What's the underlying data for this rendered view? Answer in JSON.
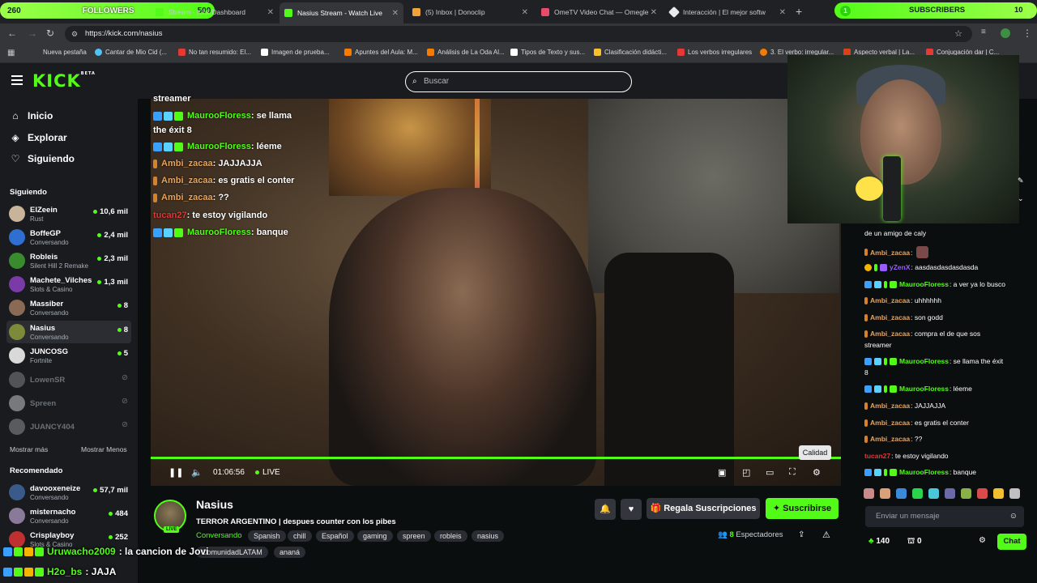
{
  "browser": {
    "tabs": [
      {
        "label": "Stream - Kick Dashboard"
      },
      {
        "label": "Nasius Stream - Watch Live"
      },
      {
        "label": "(5) Inbox | Donoclip"
      },
      {
        "label": "OmeTV Video Chat — Omegle"
      },
      {
        "label": "Interacción | El mejor softw"
      }
    ],
    "url": "https://kick.com/nasius",
    "bookmarks": [
      "Nueva pestaña",
      "Cantar de Mio Cid (...",
      "No tan resumido: El...",
      "Imagen de prueba...",
      "Apuntes del Aula: M...",
      "Análisis de La Oda Al...",
      "Tipos de Texto y sus...",
      "Clasificación didácti...",
      "Los verbos irregulares",
      "3. El verbo: irregular...",
      "Aspecto verbal | La...",
      "Conjugación dar | C..."
    ]
  },
  "overlay": {
    "followers_count": "260",
    "followers_label": "FOLLOWERS",
    "followers_goal": "500",
    "subs_count": "1",
    "subs_label": "SUBSCRIBERS",
    "subs_goal": "10",
    "bottom_chat": [
      {
        "user": "Uruwacho2009",
        "text": ": la cancion de Jovi",
        "color": "#53fc18"
      },
      {
        "user": "H2o_bs",
        "text": ": JAJA",
        "color": "#53fc18"
      }
    ]
  },
  "kick": {
    "logo": "KICK",
    "logo_badge": "BETA",
    "search_placeholder": "Buscar"
  },
  "sidebar": {
    "nav": [
      {
        "label": "Inicio",
        "icon": "home-icon"
      },
      {
        "label": "Explorar",
        "icon": "compass-icon"
      },
      {
        "label": "Siguiendo",
        "icon": "heart-icon"
      }
    ],
    "following_title": "Siguiendo",
    "following": [
      {
        "name": "ElZeein",
        "category": "Rust",
        "viewers": "10,6 mil",
        "color": "#c9b49a"
      },
      {
        "name": "BoffeGP",
        "category": "Conversando",
        "viewers": "2,4 mil",
        "color": "#2f6fd1"
      },
      {
        "name": "Robleis",
        "category": "Silent Hill 2 Remake",
        "viewers": "2,3 mil",
        "color": "#3a8a2e"
      },
      {
        "name": "Machete_Vilches",
        "category": "Slots & Casino",
        "viewers": "1,3 mil",
        "color": "#7a3aa8"
      },
      {
        "name": "Massiber",
        "category": "Conversando",
        "viewers": "8",
        "color": "#8a6a55"
      },
      {
        "name": "Nasius",
        "category": "Conversando",
        "viewers": "8",
        "color": "#7c8a3a"
      },
      {
        "name": "JUNCOSG",
        "category": "Fortnite",
        "viewers": "5",
        "color": "#d9d9d9"
      },
      {
        "name": "LowenSR",
        "category": "",
        "viewers": "",
        "color": "#999"
      },
      {
        "name": "Spreen",
        "category": "",
        "viewers": "",
        "color": "#eee"
      },
      {
        "name": "JUANCY404",
        "category": "",
        "viewers": "",
        "color": "#aaa"
      }
    ],
    "show_more": "Mostrar más",
    "show_less": "Mostrar Menos",
    "recommended_title": "Recomendado",
    "recommended": [
      {
        "name": "davooxeneize",
        "category": "Conversando",
        "viewers": "57,7 mil",
        "color": "#3a5a8a"
      },
      {
        "name": "misternacho",
        "category": "Conversando",
        "viewers": "484",
        "color": "#8a7a9a"
      },
      {
        "name": "Crisplayboy",
        "category": "Slots & Casino",
        "viewers": "252",
        "color": "#c03030"
      }
    ]
  },
  "video_chat": [
    {
      "user": "",
      "text": "streamer",
      "color": "#ffffff",
      "badges": 0
    },
    {
      "user": "MaurooFloress",
      "text": ": se llama",
      "color": "#53fc18",
      "badges": 3
    },
    {
      "user": "",
      "text": "the éxit 8",
      "color": "#ffffff",
      "badges": 0
    },
    {
      "user": "MaurooFloress",
      "text": ": léeme",
      "color": "#53fc18",
      "badges": 3
    },
    {
      "user": "Ambi_zacaa",
      "text": ": JAJJAJJA",
      "color": "#e8a35b",
      "badges": 1
    },
    {
      "user": "Ambi_zacaa",
      "text": ": es gratis el conter",
      "color": "#e8a35b",
      "badges": 1
    },
    {
      "user": "Ambi_zacaa",
      "text": ": ??",
      "color": "#e8a35b",
      "badges": 1
    },
    {
      "user": "tucan27",
      "text": ": te estoy vigilando",
      "color": "#d93a3a",
      "badges": 0
    },
    {
      "user": "MaurooFloress",
      "text": ": banque",
      "color": "#53fc18",
      "badges": 3
    }
  ],
  "player": {
    "time": "01:06:56",
    "live_label": "LIVE",
    "tooltip": "Calidad"
  },
  "stream": {
    "name": "Nasius",
    "title": "TERROR ARGENTINO | despues counter con los pibes",
    "category": "Conversando",
    "tags": [
      "Spanish",
      "chill",
      "Español",
      "gaming",
      "spreen",
      "robleis",
      "nasius",
      "ComunidadLATAM",
      "ananá"
    ],
    "gift_label": "Regala Suscripciones",
    "subscribe_label": "Suscribirse",
    "viewers": "8",
    "viewers_label": "Espectadores",
    "live_badge": "LIVE"
  },
  "chat": {
    "messages": [
      {
        "user": "",
        "text": "de un amigo de caly",
        "color": "#ffffff",
        "badges": 0
      },
      {
        "user": "Ambi_zacaa",
        "text": ":",
        "color": "#e8a35b",
        "badges": 1
      },
      {
        "user": "yZenX",
        "text": ": aasdasdasdasdasda",
        "color": "#9a5cff",
        "badges": 2
      },
      {
        "user": "MaurooFloress",
        "text": ": a ver ya lo busco",
        "color": "#53fc18",
        "badges": 3
      },
      {
        "user": "Ambi_zacaa",
        "text": ": uhhhhhh",
        "color": "#e8a35b",
        "badges": 1
      },
      {
        "user": "Ambi_zacaa",
        "text": ": son godd",
        "color": "#e8a35b",
        "badges": 1
      },
      {
        "user": "Ambi_zacaa",
        "text": ": compra el de que sos",
        "color": "#e8a35b",
        "badges": 1
      },
      {
        "user": "",
        "text": "streamer",
        "color": "#ffffff",
        "badges": 0
      },
      {
        "user": "MaurooFloress",
        "text": ": se llama the éxit",
        "color": "#53fc18",
        "badges": 3
      },
      {
        "user": "",
        "text": "8",
        "color": "#ffffff",
        "badges": 0
      },
      {
        "user": "MaurooFloress",
        "text": ": léeme",
        "color": "#53fc18",
        "badges": 3
      },
      {
        "user": "Ambi_zacaa",
        "text": ": JAJJAJJA",
        "color": "#e8a35b",
        "badges": 1
      },
      {
        "user": "Ambi_zacaa",
        "text": ": es gratis el conter",
        "color": "#e8a35b",
        "badges": 1
      },
      {
        "user": "Ambi_zacaa",
        "text": ": ??",
        "color": "#e8a35b",
        "badges": 1
      },
      {
        "user": "tucan27",
        "text": ": te estoy vigilando",
        "color": "#d93a3a",
        "badges": 0
      },
      {
        "user": "MaurooFloress",
        "text": ": banque",
        "color": "#53fc18",
        "badges": 3
      }
    ],
    "input_placeholder": "Enviar un mensaje",
    "points": "140",
    "gifts": "0",
    "send_label": "Chat"
  }
}
